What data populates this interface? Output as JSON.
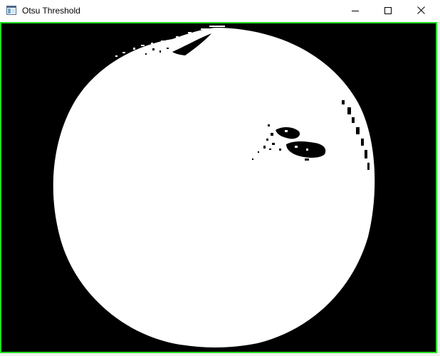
{
  "window": {
    "title": "Otsu Threshold",
    "icon": "app-window-icon",
    "controls": {
      "minimize_icon": "minimize-icon",
      "maximize_icon": "maximize-icon",
      "close_icon": "close-icon"
    }
  },
  "canvas": {
    "description_icon": "binary-threshold-image",
    "colors": {
      "background": "#000000",
      "foreground": "#ffffff",
      "frame": "#22dd22"
    }
  }
}
